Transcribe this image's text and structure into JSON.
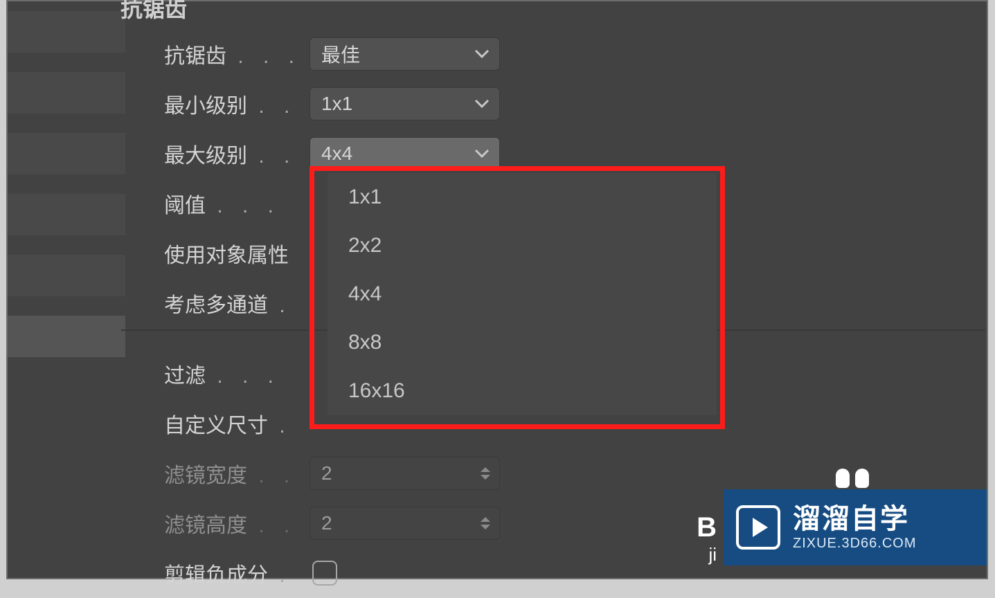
{
  "section_title": "抗锯齿",
  "dots3": ". . .",
  "dots2": ". .",
  "dots1": ".",
  "fields": {
    "antialias": {
      "label": "抗锯齿",
      "value": "最佳"
    },
    "min_level": {
      "label": "最小级别",
      "value": "1x1"
    },
    "max_level": {
      "label": "最大级别",
      "value": "4x4"
    },
    "threshold": {
      "label": "阈值"
    },
    "use_obj_props": {
      "label": "使用对象属性"
    },
    "consider_multipass": {
      "label": "考虑多通道"
    },
    "filter": {
      "label": "过滤"
    },
    "custom_size": {
      "label": "自定义尺寸"
    },
    "filter_width": {
      "label": "滤镜宽度",
      "value": "2"
    },
    "filter_height": {
      "label": "滤镜高度",
      "value": "2"
    },
    "clip_negative": {
      "label": "剪辑负成分"
    }
  },
  "dropdown_options": [
    "1x1",
    "2x2",
    "4x4",
    "8x8",
    "16x16"
  ],
  "watermark": {
    "main": "溜溜自学",
    "sub": "ZIXUE.3D66.COM"
  },
  "behind_B": "B",
  "behind_j": "ji"
}
